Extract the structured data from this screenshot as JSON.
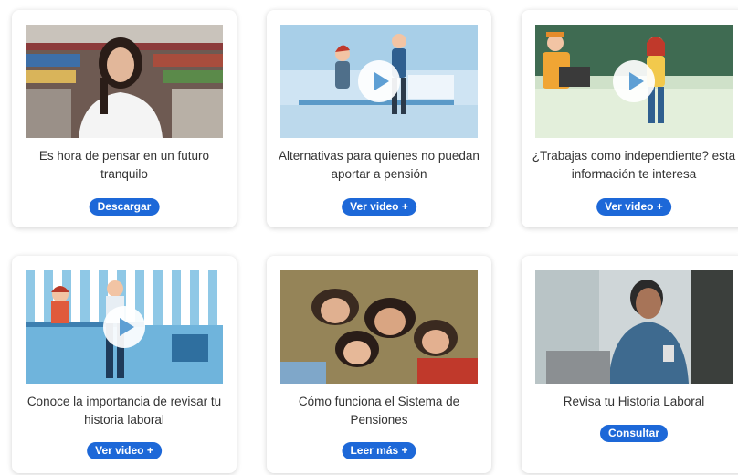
{
  "cards": [
    {
      "title": "Es hora de pensar en un futuro tranquilo",
      "button": "Descargar"
    },
    {
      "title": "Alternativas para quienes no puedan aportar a pensión",
      "button": "Ver video +"
    },
    {
      "title": "¿Trabajas como independiente? esta información te interesa",
      "button": "Ver video +"
    },
    {
      "title": "Conoce la importancia de revisar tu historia laboral",
      "button": "Ver video +"
    },
    {
      "title": "Cómo funciona el Sistema de Pensiones",
      "button": "Leer más +"
    },
    {
      "title": "Revisa tu Historia Laboral",
      "button": "Consultar"
    }
  ],
  "colors": {
    "button": "#1d68d8",
    "text": "#333333",
    "card_bg": "#ffffff"
  }
}
